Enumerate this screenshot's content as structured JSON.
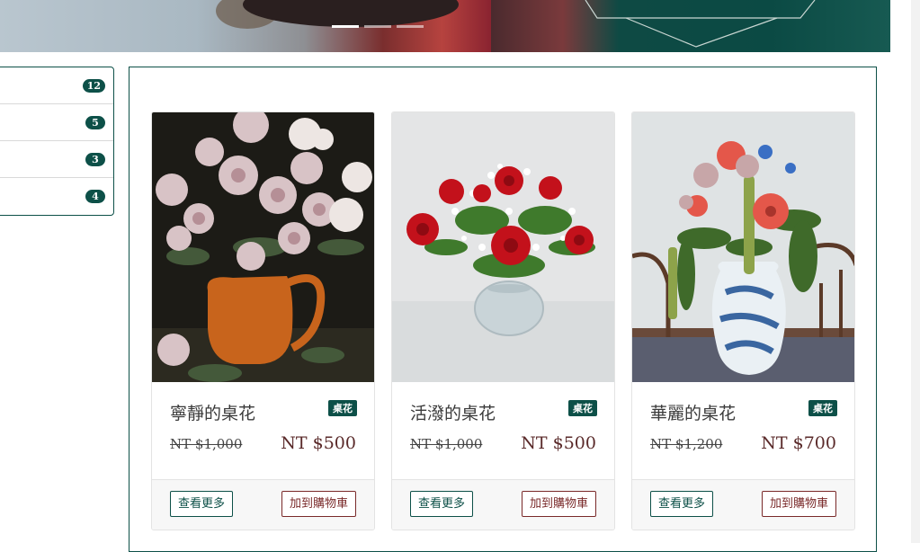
{
  "carousel": {
    "indicators": [
      "slide-1",
      "slide-2",
      "slide-3"
    ],
    "active_index": 0
  },
  "categories": [
    {
      "count": "12"
    },
    {
      "count": "5"
    },
    {
      "count": "3"
    },
    {
      "count": "4"
    }
  ],
  "products": [
    {
      "title": "寧靜的桌花",
      "tag": "桌花",
      "original_price": "NT $1,000",
      "price": "NT $500",
      "more_label": "查看更多",
      "cart_label": "加到購物車"
    },
    {
      "title": "活潑的桌花",
      "tag": "桌花",
      "original_price": "NT $1,000",
      "price": "NT $500",
      "more_label": "查看更多",
      "cart_label": "加到購物車"
    },
    {
      "title": "華麗的桌花",
      "tag": "桌花",
      "original_price": "NT $1,200",
      "price": "NT $700",
      "more_label": "查看更多",
      "cart_label": "加到購物車"
    }
  ],
  "colors": {
    "brand": "#0d5048",
    "accent": "#7a2a2a"
  }
}
